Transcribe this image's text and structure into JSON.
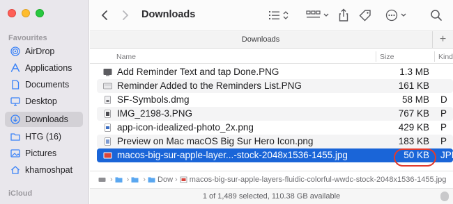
{
  "sidebar": {
    "favourites_heading": "Favourites",
    "icloud_heading": "iCloud",
    "items": [
      {
        "label": "AirDrop",
        "icon": "airdrop-icon"
      },
      {
        "label": "Applications",
        "icon": "applications-icon"
      },
      {
        "label": "Documents",
        "icon": "document-icon"
      },
      {
        "label": "Desktop",
        "icon": "desktop-icon"
      },
      {
        "label": "Downloads",
        "icon": "downloads-icon"
      },
      {
        "label": "HTG (16)",
        "icon": "folder-icon"
      },
      {
        "label": "Pictures",
        "icon": "pictures-icon"
      },
      {
        "label": "khamoshpat",
        "icon": "home-icon"
      }
    ]
  },
  "toolbar": {
    "title": "Downloads"
  },
  "tabbar": {
    "label": "Downloads",
    "add": "+"
  },
  "columns": {
    "name": "Name",
    "size": "Size",
    "kind": "Kind"
  },
  "files": [
    {
      "name": "Add Reminder Text and tap Done.PNG",
      "size": "1.3 MB",
      "kind": ""
    },
    {
      "name": "Reminder Added to the Reminders List.PNG",
      "size": "161 KB",
      "kind": ""
    },
    {
      "name": "SF-Symbols.dmg",
      "size": "58 MB",
      "kind": "D"
    },
    {
      "name": "IMG_2198-3.PNG",
      "size": "767 KB",
      "kind": "P"
    },
    {
      "name": "app-icon-idealized-photo_2x.png",
      "size": "429 KB",
      "kind": "P"
    },
    {
      "name": "Preview on Mac macOS Big Sur Hero Icon.png",
      "size": "183 KB",
      "kind": "P"
    },
    {
      "name": "macos-big-sur-apple-layer...-stock-2048x1536-1455.jpg",
      "size": "50 KB",
      "kind": "JPE"
    }
  ],
  "pathbar": {
    "folder": "Dow",
    "file": "macos-big-sur-apple-layers-fluidic-colorful-wwdc-stock-2048x1536-1455.jpg"
  },
  "status": {
    "text": "1 of 1,489 selected, 110.38 GB available"
  },
  "colors": {
    "selection": "#1a65d8",
    "highlight_ring": "#e23b2e"
  }
}
